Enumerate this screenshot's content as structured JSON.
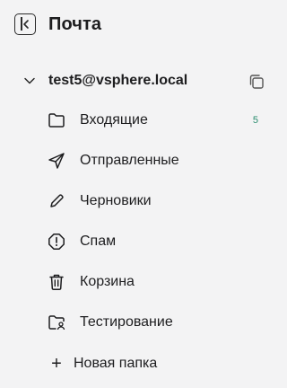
{
  "header": {
    "title": "Почта",
    "collapse_icon": "sidebar-collapse-icon"
  },
  "account": {
    "name": "test5@vsphere.local",
    "expand_icon": "chevron-down-icon",
    "copy_icon": "copy-icon"
  },
  "folders": [
    {
      "label": "Входящие",
      "icon": "folder-icon",
      "count": "5"
    },
    {
      "label": "Отправленные",
      "icon": "send-icon",
      "count": ""
    },
    {
      "label": "Черновики",
      "icon": "pencil-icon",
      "count": ""
    },
    {
      "label": "Спам",
      "icon": "spam-icon",
      "count": ""
    },
    {
      "label": "Корзина",
      "icon": "trash-icon",
      "count": ""
    },
    {
      "label": "Тестирование",
      "icon": "shared-folder-icon",
      "count": ""
    }
  ],
  "new_folder": {
    "label": "Новая папка",
    "icon": "plus-icon"
  },
  "colors": {
    "background": "#f3f3f4",
    "text": "#1d1d1f",
    "count": "#2a8c6e"
  }
}
